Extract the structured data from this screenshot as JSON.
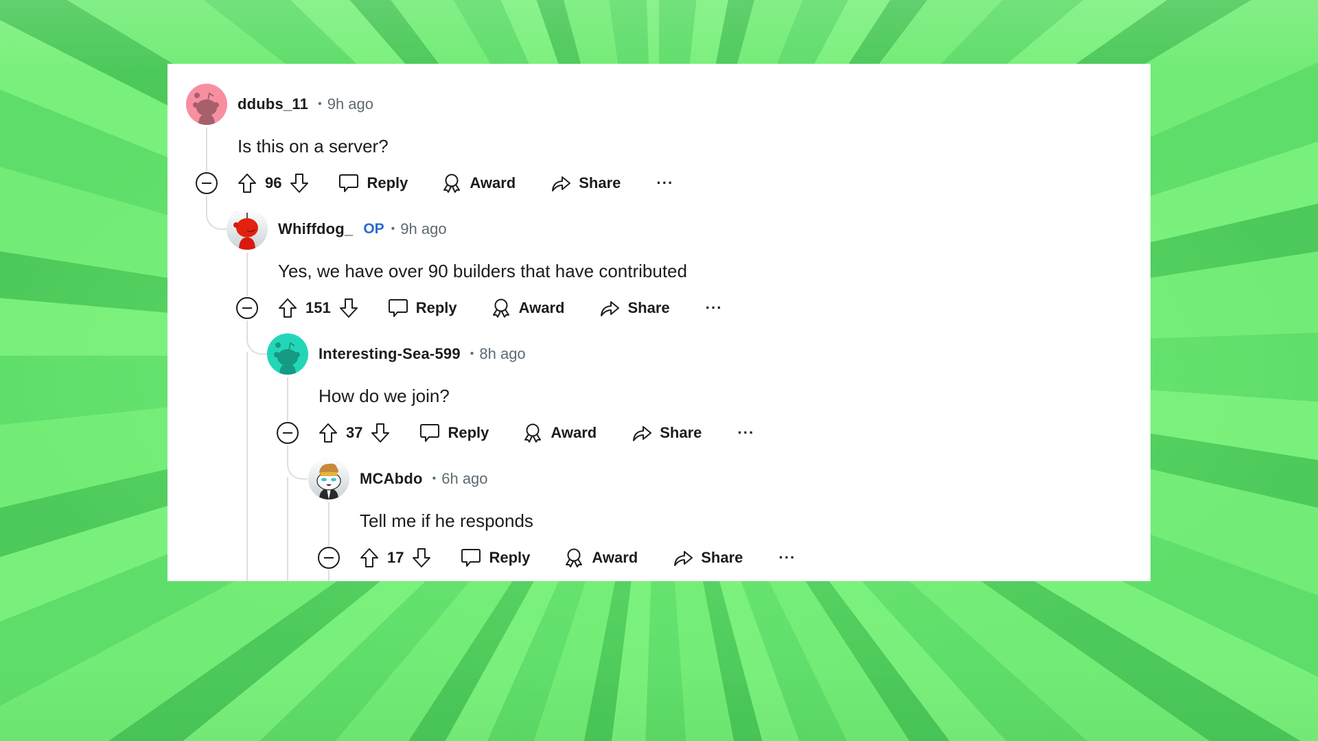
{
  "thread": {
    "comments": [
      {
        "username": "ddubs_11",
        "is_op": false,
        "time": "9h ago",
        "text": "Is this on a server?",
        "score": "96",
        "avatar_color": "#f88fa1",
        "avatar_icon": "snoo-avatar-default-pink"
      },
      {
        "username": "Whiffdog_",
        "is_op": true,
        "op_label": "OP",
        "time": "9h ago",
        "text": "Yes, we have over 90 builders that have contributed",
        "score": "151",
        "avatar_color": "#e3e8eb",
        "avatar_icon": "snoo-avatar-red-custom"
      },
      {
        "username": "Interesting-Sea-599",
        "is_op": false,
        "time": "8h ago",
        "text": "How do we join?",
        "score": "37",
        "avatar_color": "#24d6b8",
        "avatar_icon": "snoo-avatar-default-teal"
      },
      {
        "username": "MCAbdo",
        "is_op": false,
        "time": "6h ago",
        "text": "Tell me if he responds",
        "score": "17",
        "avatar_color": "#e3e8eb",
        "avatar_icon": "snoo-avatar-custom-crown"
      }
    ],
    "actions": {
      "reply": "Reply",
      "award": "Award",
      "share": "Share",
      "more": "···"
    },
    "separator": "•"
  },
  "colors": {
    "background_green": "#6fe775",
    "text_primary": "#1c1c1c",
    "text_meta": "#5d6b73",
    "op_badge": "#2a6ad4",
    "thread_line": "#dcdfe1"
  }
}
